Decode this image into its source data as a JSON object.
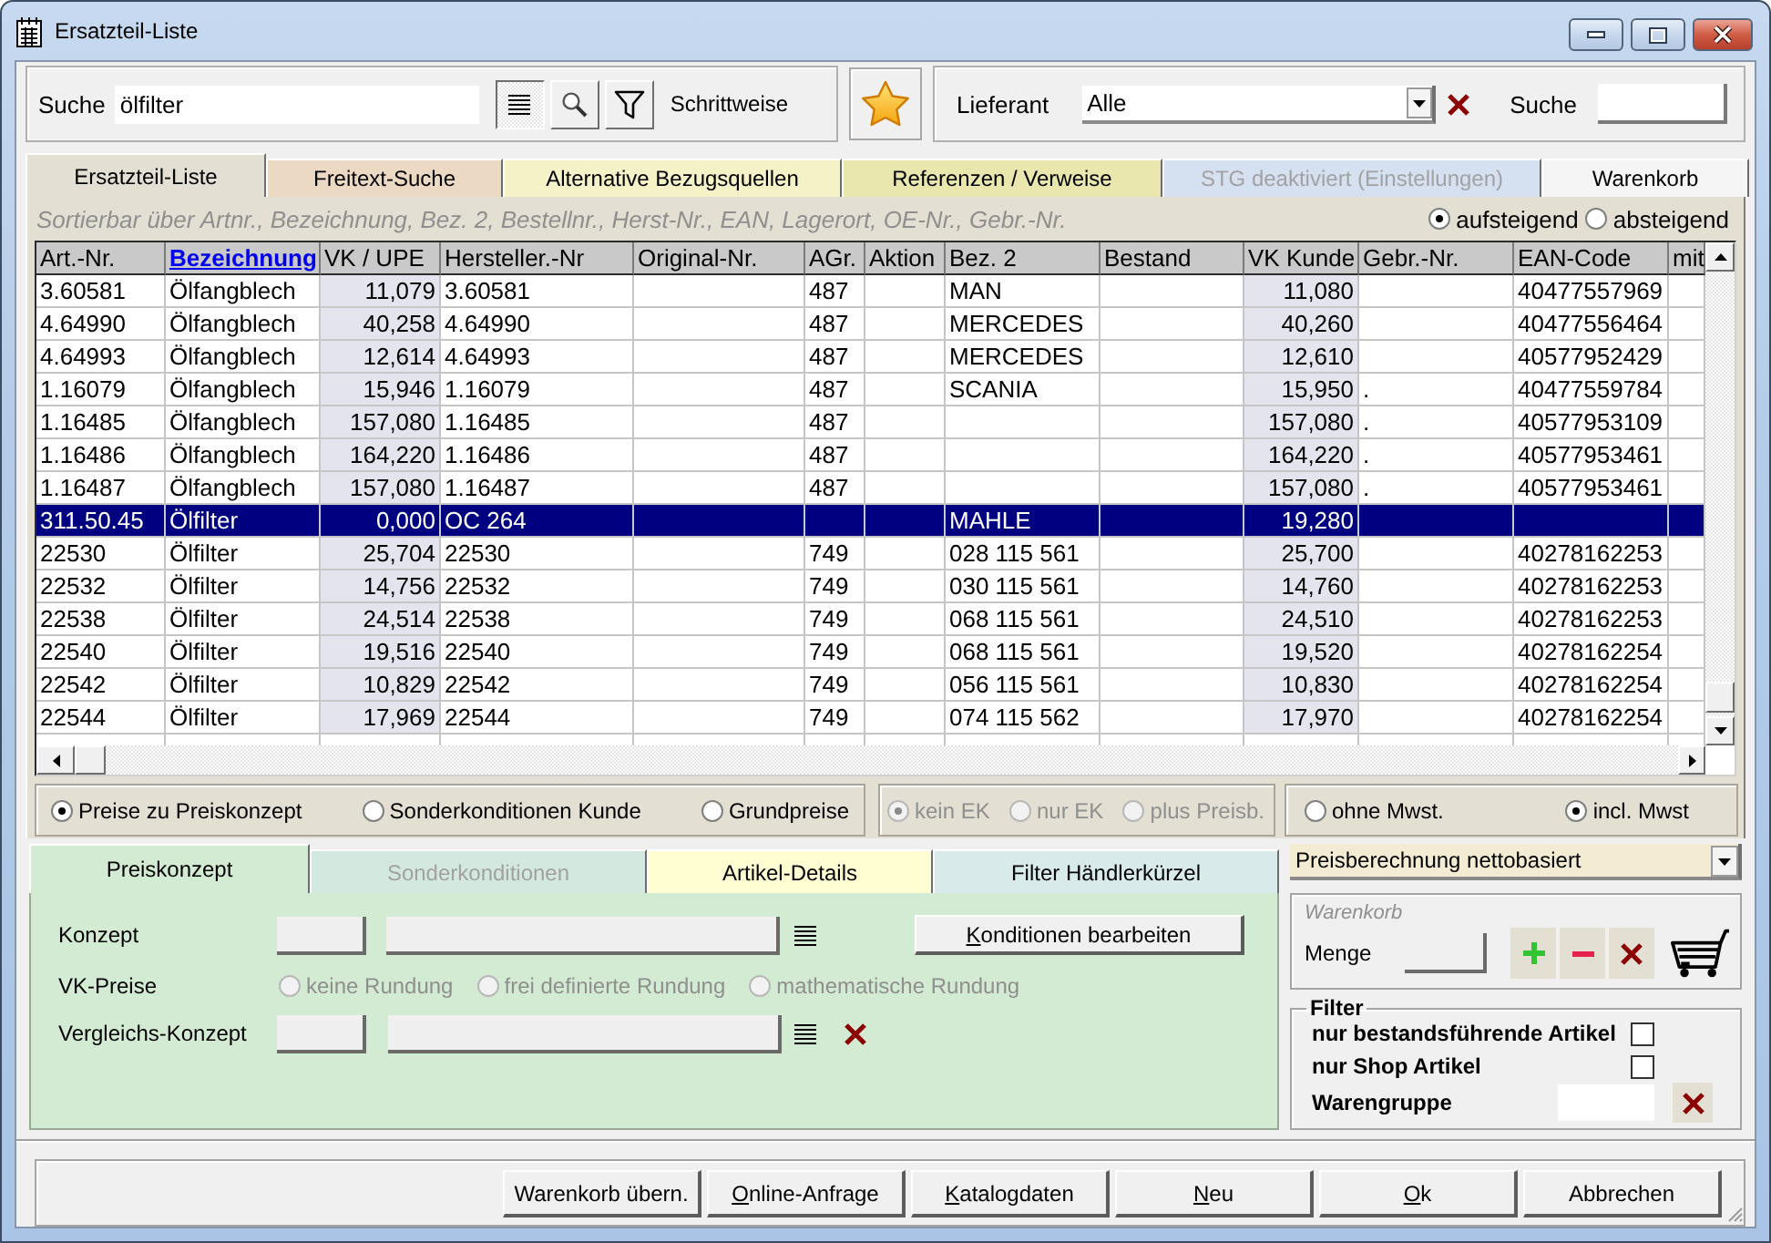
{
  "window": {
    "title": "Ersatzteil-Liste"
  },
  "search": {
    "label": "Suche",
    "value": "ölfilter",
    "list_button_pressed": true,
    "mode_label": "Schrittweise"
  },
  "supplier": {
    "label": "Lieferant",
    "value": "Alle",
    "search_label": "Suche"
  },
  "tabs": [
    {
      "label": "Ersatzteil-Liste",
      "selected": true,
      "disabled": false,
      "color": "#e3dfd3"
    },
    {
      "label": "Freitext-Suche",
      "selected": false,
      "disabled": false,
      "color": "#ecd9c3"
    },
    {
      "label": "Alternative Bezugsquellen",
      "selected": false,
      "disabled": false,
      "color": "#f4f2c6"
    },
    {
      "label": "Referenzen / Verweise",
      "selected": false,
      "disabled": false,
      "color": "#e9e7ae"
    },
    {
      "label": "STG deaktiviert (Einstellungen)",
      "selected": false,
      "disabled": true,
      "color": "#d5e1f1"
    },
    {
      "label": "Warenkorb",
      "selected": false,
      "disabled": false,
      "color": "#f5f5f5"
    }
  ],
  "sort": {
    "hint": "Sortierbar über Artnr., Bezeichnung, Bez. 2, Bestellnr., Herst-Nr., EAN, Lagerort, OE-Nr., Gebr.-Nr.",
    "order": [
      {
        "label": "aufsteigend",
        "selected": true
      },
      {
        "label": "absteigend",
        "selected": false
      }
    ]
  },
  "table": {
    "columns": [
      {
        "label": "Art.-Nr.",
        "kind": "text",
        "sorted": false
      },
      {
        "label": "Bezeichnung",
        "kind": "text",
        "sorted": true
      },
      {
        "label": "VK / UPE",
        "kind": "price",
        "sorted": false
      },
      {
        "label": "Hersteller.-Nr",
        "kind": "text",
        "sorted": false
      },
      {
        "label": "Original-Nr.",
        "kind": "text",
        "sorted": false
      },
      {
        "label": "AGr.",
        "kind": "text",
        "sorted": false
      },
      {
        "label": "Aktion",
        "kind": "text",
        "sorted": false
      },
      {
        "label": "Bez. 2",
        "kind": "text",
        "sorted": false
      },
      {
        "label": "Bestand",
        "kind": "text",
        "sorted": false
      },
      {
        "label": "VK Kunde",
        "kind": "price",
        "sorted": false
      },
      {
        "label": "Gebr.-Nr.",
        "kind": "text",
        "sorted": false
      },
      {
        "label": "EAN-Code",
        "kind": "text",
        "sorted": false
      },
      {
        "label": "mit",
        "kind": "text",
        "sorted": false
      }
    ],
    "rows": [
      {
        "selected": false,
        "art_nr": "3.60581",
        "bezeichnung": "Ölfangblech",
        "vk_upe": "11,079",
        "hersteller_nr": "3.60581",
        "agr": "487",
        "bez_2": "MAN",
        "vk_kunde": "11,080",
        "ean_code": "40477557969"
      },
      {
        "selected": false,
        "art_nr": "4.64990",
        "bezeichnung": "Ölfangblech",
        "vk_upe": "40,258",
        "hersteller_nr": "4.64990",
        "agr": "487",
        "bez_2": "MERCEDES",
        "vk_kunde": "40,260",
        "ean_code": "40477556464"
      },
      {
        "selected": false,
        "art_nr": "4.64993",
        "bezeichnung": "Ölfangblech",
        "vk_upe": "12,614",
        "hersteller_nr": "4.64993",
        "agr": "487",
        "bez_2": "MERCEDES",
        "vk_kunde": "12,610",
        "ean_code": "40577952429"
      },
      {
        "selected": false,
        "art_nr": "1.16079",
        "bezeichnung": "Ölfangblech",
        "vk_upe": "15,946",
        "hersteller_nr": "1.16079",
        "agr": "487",
        "bez_2": "SCANIA",
        "vk_kunde": "15,950",
        "gebr_nr": ".",
        "ean_code": "40477559784"
      },
      {
        "selected": false,
        "art_nr": "1.16485",
        "bezeichnung": "Ölfangblech",
        "vk_upe": "157,080",
        "hersteller_nr": "1.16485",
        "agr": "487",
        "vk_kunde": "157,080",
        "gebr_nr": ".",
        "ean_code": "40577953109"
      },
      {
        "selected": false,
        "art_nr": "1.16486",
        "bezeichnung": "Ölfangblech",
        "vk_upe": "164,220",
        "hersteller_nr": "1.16486",
        "agr": "487",
        "vk_kunde": "164,220",
        "gebr_nr": ".",
        "ean_code": "40577953461"
      },
      {
        "selected": false,
        "art_nr": "1.16487",
        "bezeichnung": "Ölfangblech",
        "vk_upe": "157,080",
        "hersteller_nr": "1.16487",
        "agr": "487",
        "vk_kunde": "157,080",
        "gebr_nr": ".",
        "ean_code": "40577953461"
      },
      {
        "selected": true,
        "art_nr": "311.50.45",
        "bezeichnung": "Ölfilter",
        "vk_upe": "0,000",
        "hersteller_nr": "OC 264",
        "bez_2": "MAHLE",
        "vk_kunde": "19,280"
      },
      {
        "selected": false,
        "art_nr": "22530",
        "bezeichnung": "Ölfilter",
        "vk_upe": "25,704",
        "hersteller_nr": "22530",
        "agr": "749",
        "bez_2": "028 115 561",
        "vk_kunde": "25,700",
        "ean_code": "40278162253"
      },
      {
        "selected": false,
        "art_nr": "22532",
        "bezeichnung": "Ölfilter",
        "vk_upe": "14,756",
        "hersteller_nr": "22532",
        "agr": "749",
        "bez_2": "030 115 561",
        "vk_kunde": "14,760",
        "ean_code": "40278162253"
      },
      {
        "selected": false,
        "art_nr": "22538",
        "bezeichnung": "Ölfilter",
        "vk_upe": "24,514",
        "hersteller_nr": "22538",
        "agr": "749",
        "bez_2": "068 115 561",
        "vk_kunde": "24,510",
        "ean_code": "40278162253"
      },
      {
        "selected": false,
        "art_nr": "22540",
        "bezeichnung": "Ölfilter",
        "vk_upe": "19,516",
        "hersteller_nr": "22540",
        "agr": "749",
        "bez_2": "068 115 561",
        "vk_kunde": "19,520",
        "ean_code": "40278162254"
      },
      {
        "selected": false,
        "art_nr": "22542",
        "bezeichnung": "Ölfilter",
        "vk_upe": "10,829",
        "hersteller_nr": "22542",
        "agr": "749",
        "bez_2": "056 115 561",
        "vk_kunde": "10,830",
        "ean_code": "40278162254"
      },
      {
        "selected": false,
        "art_nr": "22544",
        "bezeichnung": "Ölfilter",
        "vk_upe": "17,969",
        "hersteller_nr": "22544",
        "agr": "749",
        "bez_2": "074 115 562",
        "vk_kunde": "17,970",
        "ean_code": "40278162254"
      }
    ]
  },
  "price_basis": [
    {
      "label": "Preise zu Preiskonzept",
      "selected": true
    },
    {
      "label": "Sonderkonditionen Kunde",
      "selected": false
    },
    {
      "label": "Grundpreise",
      "selected": false
    }
  ],
  "purchase_price": [
    {
      "label": "kein EK",
      "selected": true,
      "disabled": true
    },
    {
      "label": "nur EK",
      "selected": false,
      "disabled": true
    },
    {
      "label": "plus Preisb.",
      "selected": false,
      "disabled": true
    }
  ],
  "vat": [
    {
      "label": "ohne Mwst.",
      "selected": false
    },
    {
      "label": "incl. Mwst",
      "selected": true
    }
  ],
  "detail_tabs": [
    {
      "label": "Preiskonzept",
      "selected": true,
      "disabled": false,
      "color": "#d4ebd3"
    },
    {
      "label": "Sonderkonditionen",
      "selected": false,
      "disabled": true,
      "color": "#d3e9df"
    },
    {
      "label": "Artikel-Details",
      "selected": false,
      "disabled": false,
      "color": "#fefed2"
    },
    {
      "label": "Filter Händlerkürzel",
      "selected": false,
      "disabled": false,
      "color": "#d9eaea"
    }
  ],
  "price_concept": {
    "concept_label": "Konzept",
    "edit_button": {
      "label": "Konditionen bearbeiten",
      "mnemonic": true
    },
    "prices_label": "VK-Preise",
    "rounding": [
      {
        "label": "keine Rundung",
        "selected": false,
        "disabled": true
      },
      {
        "label": "frei definierte Rundung",
        "selected": false,
        "disabled": true
      },
      {
        "label": "mathematische Rundung",
        "selected": false,
        "disabled": true
      }
    ],
    "compare_label": "Vergleichs-Konzept"
  },
  "calculation": {
    "value": "Preisberechnung nettobasiert"
  },
  "basket": {
    "title": "Warenkorb",
    "quantity_label": "Menge"
  },
  "filter": {
    "title": "Filter",
    "options": [
      {
        "label": "nur bestandsführende Artikel",
        "checked": false
      },
      {
        "label": "nur Shop Artikel",
        "checked": false
      }
    ],
    "group_label": "Warengruppe"
  },
  "buttons": [
    {
      "label": "Warenkorb übern.",
      "mnemonic": false
    },
    {
      "label": "Online-Anfrage",
      "mnemonic": true
    },
    {
      "label": "Katalogdaten",
      "mnemonic": true
    },
    {
      "label": "Neu",
      "mnemonic": true
    },
    {
      "label": "Ok",
      "mnemonic": true
    },
    {
      "label": "Abbrechen",
      "mnemonic": false
    }
  ]
}
